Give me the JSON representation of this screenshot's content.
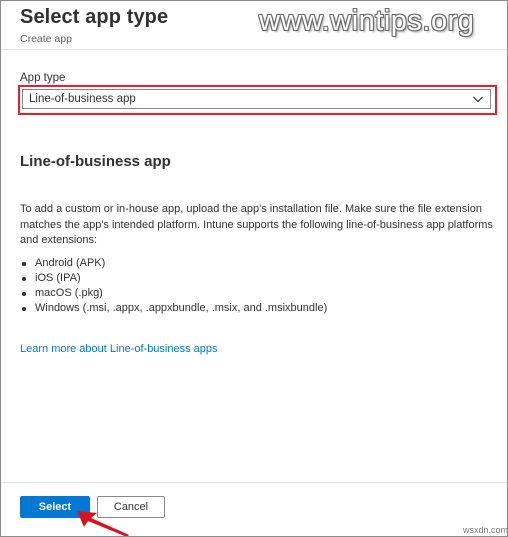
{
  "blade": {
    "title": "Select app type",
    "subtitle": "Create app"
  },
  "watermark": "www.wintips.org",
  "form": {
    "app_type_label": "App type",
    "app_type_value": "Line-of-business app"
  },
  "section": {
    "heading": "Line-of-business app",
    "description": "To add a custom or in-house app, upload the app's installation file. Make sure the file extension matches the app's intended platform. Intune supports the following line-of-business app platforms and extensions:",
    "platforms": [
      "Android (APK)",
      "iOS (IPA)",
      "macOS (.pkg)",
      "Windows (.msi, .appx, .appxbundle, .msix, and .msixbundle)"
    ],
    "learn_more": "Learn more about Line-of-business apps"
  },
  "footer": {
    "select_label": "Select",
    "cancel_label": "Cancel"
  },
  "site_mark": "wsxdn.com",
  "colors": {
    "accent": "#0078d4",
    "highlight": "#e8202a",
    "arrow": "#d9121c"
  },
  "icons": {
    "dropdown": "chevron-down-icon",
    "pointer": "red-arrow-icon"
  }
}
